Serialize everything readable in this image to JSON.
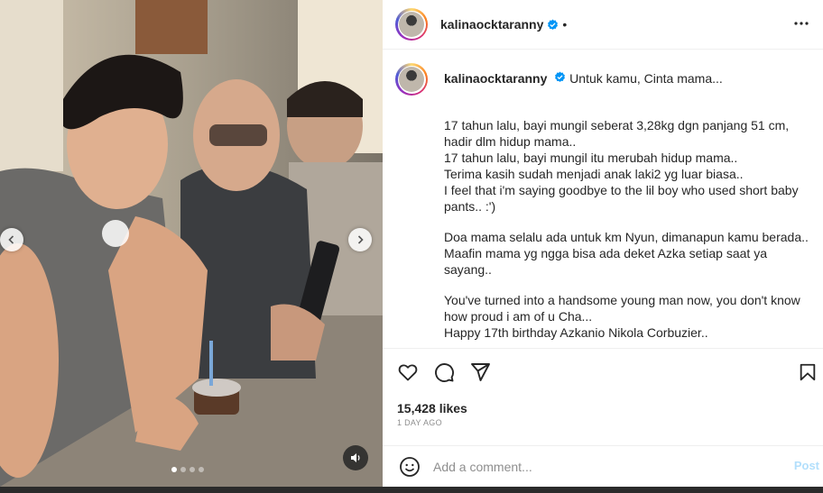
{
  "post": {
    "username": "kalinaocktaranny",
    "header_separator": "•",
    "caption_intro": "Untuk kamu, Cinta mama...",
    "caption_paragraphs": [
      "17 tahun lalu, bayi mungil seberat 3,28kg dgn panjang 51 cm,\nhadir dlm hidup mama..\n17 tahun lalu, bayi mungil itu merubah hidup mama..\nTerima kasih sudah menjadi anak laki2 yg luar biasa..\nI feel that i'm saying goodbye to the lil boy who used short baby\npants.. :')",
      "Doa mama selalu ada untuk km Nyun, dimanapun kamu berada..\nMaafin mama yg ngga bisa ada deket Azka setiap saat ya\nsayang..",
      "You've turned into a handsome young man now, you don't know\nhow proud i am of u Cha...\nHappy 17th birthday Azkanio Nikola Corbuzier.."
    ],
    "likes": "15,428 likes",
    "time_ago": "1 DAY AGO"
  },
  "comment": {
    "placeholder": "Add a comment...",
    "post_label": "Post"
  },
  "carousel": {
    "slide_count": 4,
    "active_slide": 1
  },
  "icons": {
    "verified": "verified-badge-icon",
    "more": "more-options-icon",
    "like": "heart-icon",
    "comment": "comment-bubble-icon",
    "share": "paper-plane-icon",
    "save": "bookmark-icon",
    "emoji": "smiley-icon",
    "sound": "speaker-icon",
    "prev": "chevron-left-icon",
    "next": "chevron-right-icon"
  },
  "colors": {
    "verified_blue": "#0095f6",
    "post_disabled": "#b2dffc",
    "text_primary": "#262626",
    "text_secondary": "#8e8e8e"
  }
}
